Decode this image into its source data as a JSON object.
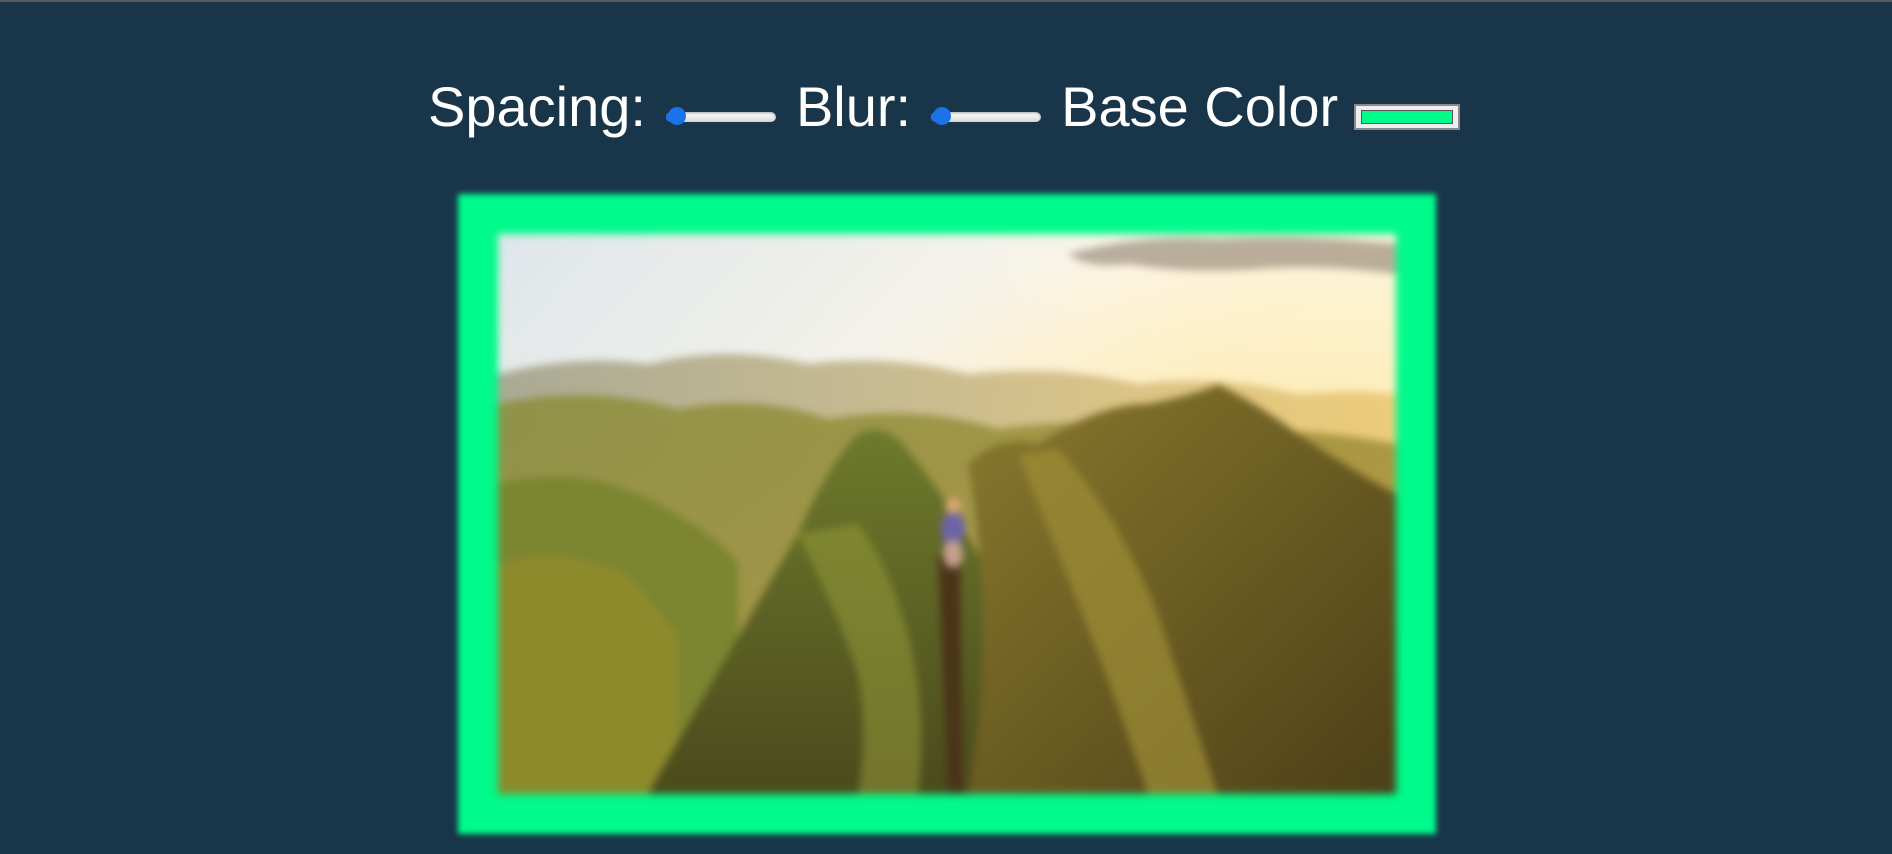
{
  "controls": {
    "spacing": {
      "label": "Spacing:",
      "value": 0.1
    },
    "blur": {
      "label": "Blur:",
      "value": 0.1
    },
    "base_color": {
      "label": "Base Color",
      "value": "#00fa8b"
    }
  },
  "colors": {
    "background": "#193549",
    "accent": "#00fa8b",
    "slider_accent": "#1a73e8"
  },
  "image": {
    "subject": "mountain-ridge-hiker-sunset-photo"
  }
}
